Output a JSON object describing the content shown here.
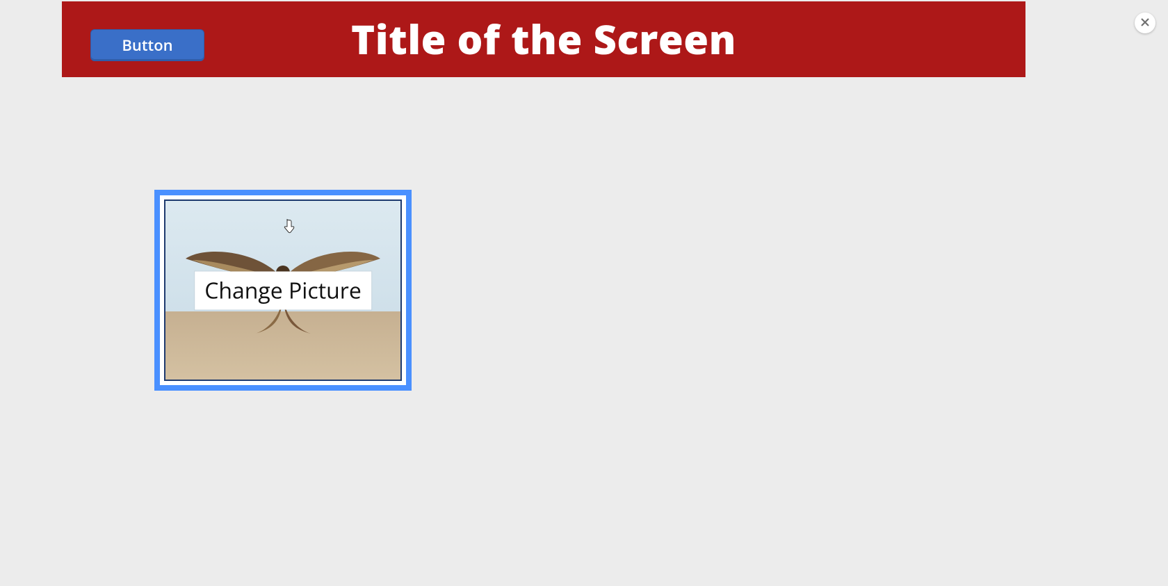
{
  "header": {
    "title": "Title of the Screen",
    "button_label": "Button"
  },
  "picture_card": {
    "overlay_label": "Change Picture",
    "image_description": "falcon-in-flight"
  },
  "colors": {
    "header_bg": "#ad1818",
    "primary_button": "#3a6fc8",
    "selection_border": "#4a90ff"
  }
}
